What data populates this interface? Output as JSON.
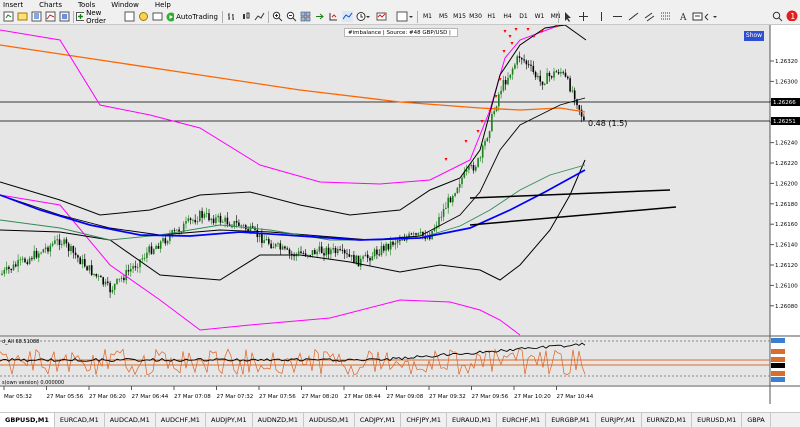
{
  "menu": [
    "Insert",
    "Charts",
    "Tools",
    "Window",
    "Help"
  ],
  "toolbar": {
    "new_order": "New Order",
    "autotrading": "AutoTrading",
    "timeframes": [
      "M1",
      "M5",
      "M15",
      "M30",
      "H1",
      "H4",
      "D1",
      "W1",
      "MN"
    ]
  },
  "indicator_label": "#imbalance | Source: #48 GBP/USD |",
  "show_label": "Show",
  "annotation": "0.48 (1.5)",
  "price_labels": [
    "1.26320",
    "1.26300",
    "1.26280",
    "1.26260",
    "1.26240",
    "1.26220",
    "1.26200",
    "1.26180",
    "1.26160",
    "1.26140",
    "1.26120",
    "1.26100",
    "1.26080"
  ],
  "highlight_prices": [
    "1.26266",
    "1.26251"
  ],
  "time_labels": [
    "Mar 05:32",
    "27 Mar 05:56",
    "27 Mar 06:20",
    "27 Mar 06:44",
    "27 Mar 07:08",
    "27 Mar 07:32",
    "27 Mar 07:56",
    "27 Mar 08:20",
    "27 Mar 08:44",
    "27 Mar 09:08",
    "27 Mar 09:32",
    "27 Mar 09:56",
    "27 Mar 10:20",
    "27 Mar 10:44"
  ],
  "sub1_label": "d_All 68.51088",
  "sub2_label": "s(own version) 0.000000",
  "tabs": [
    "GBPUSD,M1",
    "EURCAD,M1",
    "AUDCAD,M1",
    "AUDCHF,M1",
    "AUDJPY,M1",
    "AUDNZD,M1",
    "AUDUSD,M1",
    "CADJPY,M1",
    "CHFJPY,M1",
    "EURAUD,M1",
    "EURCHF,M1",
    "EURGBP,M1",
    "EURJPY,M1",
    "EURNZD,M1",
    "EURUSD,M1",
    "GBPA"
  ],
  "colors": {
    "chart_bg": "#e6e6e6",
    "up": "#1a7f1a",
    "down": "#000000",
    "bands": "#000000",
    "outer_bands": "#ff00ff",
    "ma_blue": "#0000ff",
    "ma_orange": "#ff6600",
    "signal": "#ff0000"
  }
}
